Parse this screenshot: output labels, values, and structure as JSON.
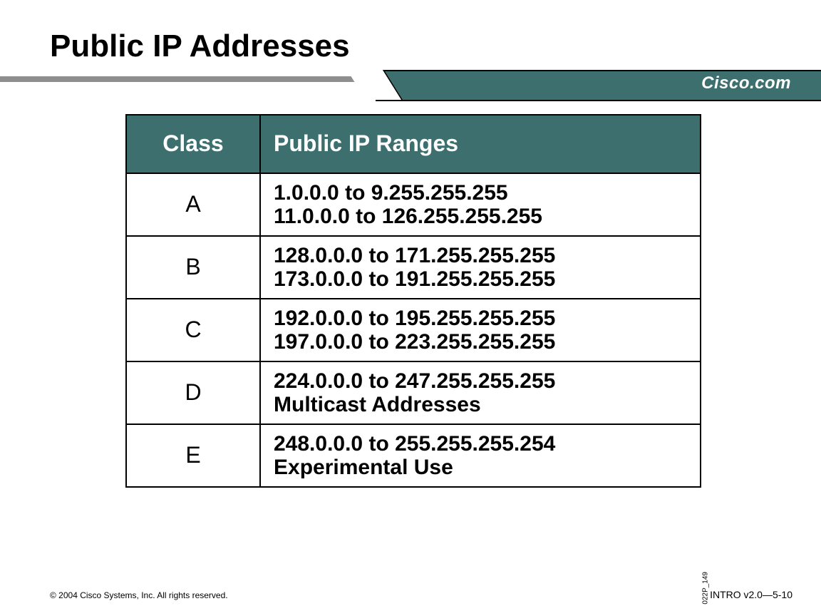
{
  "title": "Public IP Addresses",
  "brand": "Cisco.com",
  "table": {
    "headers": {
      "class": "Class",
      "ranges": "Public IP Ranges"
    },
    "rows": [
      {
        "class": "A",
        "line1": "1.0.0.0 to 9.255.255.255",
        "line2": "11.0.0.0 to 126.255.255.255"
      },
      {
        "class": "B",
        "line1": "128.0.0.0 to 171.255.255.255",
        "line2": "173.0.0.0 to 191.255.255.255"
      },
      {
        "class": "C",
        "line1": "192.0.0.0 to 195.255.255.255",
        "line2": "197.0.0.0 to 223.255.255.255"
      },
      {
        "class": "D",
        "line1": "224.0.0.0 to 247.255.255.255",
        "line2": "Multicast Addresses"
      },
      {
        "class": "E",
        "line1": "248.0.0.0 to 255.255.255.254",
        "line2": "Experimental Use"
      }
    ]
  },
  "side_label": "022P_149",
  "footer": {
    "left": "© 2004 Cisco Systems, Inc. All rights reserved.",
    "right": "INTRO v2.0—5-10"
  }
}
